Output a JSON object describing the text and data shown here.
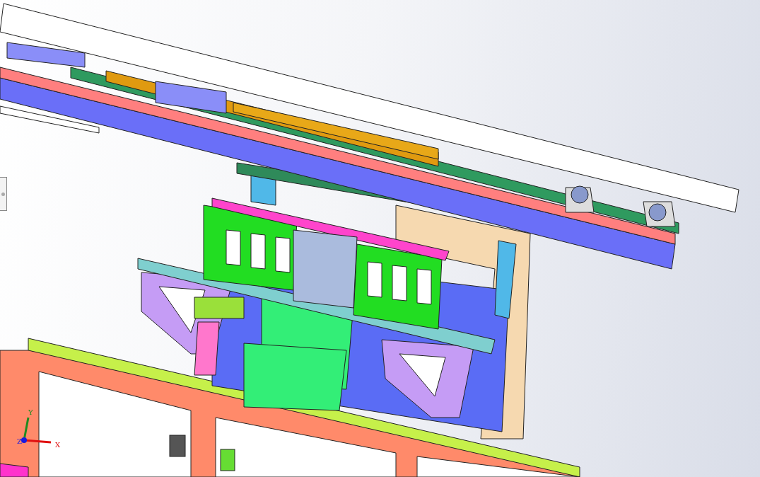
{
  "viewport": {
    "triad": {
      "axes": [
        {
          "label": "Y",
          "color": "#1f8a1f"
        },
        {
          "label": "X",
          "color": "#e01010"
        },
        {
          "label": "Z",
          "color": "#1a1ae0"
        }
      ]
    }
  }
}
